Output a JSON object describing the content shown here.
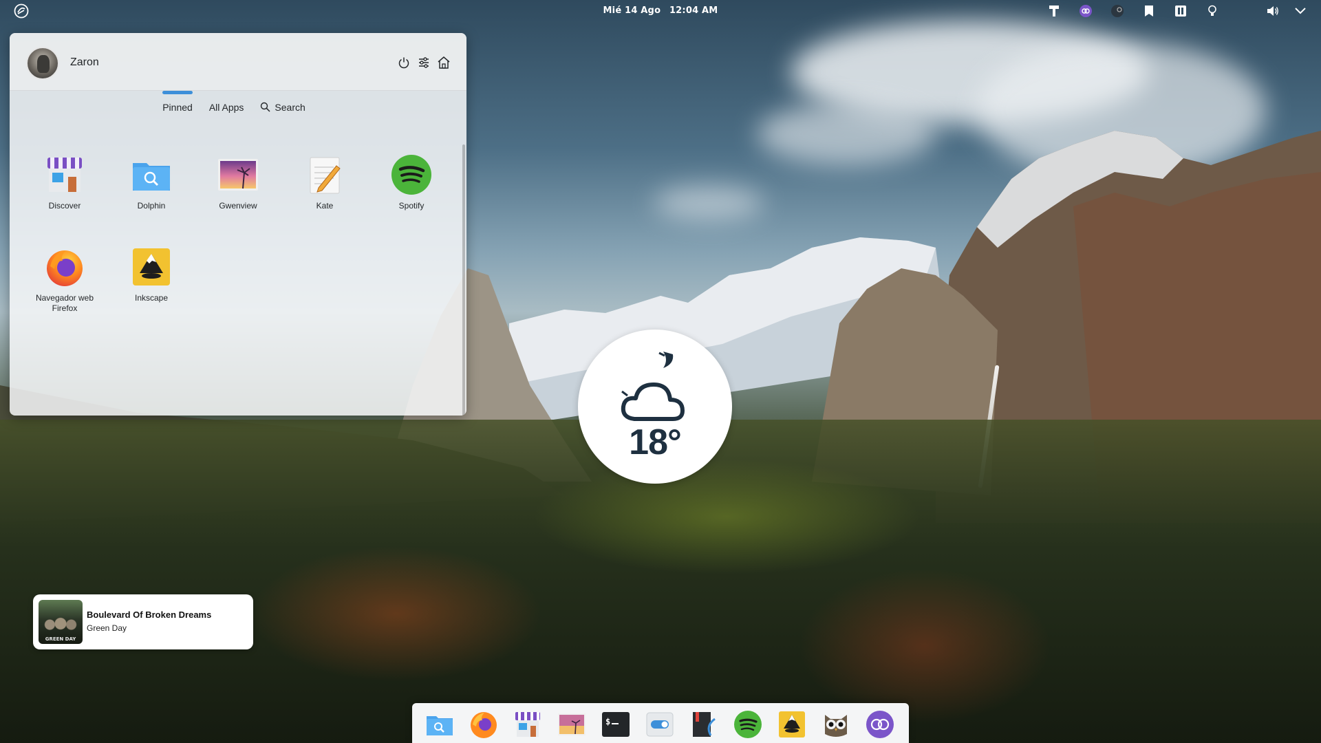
{
  "panel": {
    "date": "Mié 14 Ago",
    "time": "12:04 AM"
  },
  "launcher": {
    "user_name": "Zaron",
    "tabs": [
      {
        "label": "Pinned",
        "active": true
      },
      {
        "label": "All Apps",
        "active": false
      },
      {
        "label": "Search",
        "active": false
      }
    ],
    "apps": [
      {
        "label": "Discover",
        "icon": "discover-icon"
      },
      {
        "label": "Dolphin",
        "icon": "dolphin-icon"
      },
      {
        "label": "Gwenview",
        "icon": "gwenview-icon"
      },
      {
        "label": "Kate",
        "icon": "kate-icon"
      },
      {
        "label": "Spotify",
        "icon": "spotify-icon"
      },
      {
        "label": "Navegador web Firefox",
        "icon": "firefox-icon"
      },
      {
        "label": "Inkscape",
        "icon": "inkscape-icon"
      }
    ],
    "header_actions": [
      "power-icon",
      "settings-sliders-icon",
      "home-icon"
    ]
  },
  "weather": {
    "temperature": "18°",
    "condition_icon": "cloud-night-icon"
  },
  "now_playing": {
    "title": "Boulevard Of Broken Dreams",
    "artist": "Green Day",
    "album_art_text": "GREEN DAY"
  },
  "dock": {
    "items": [
      "dolphin-icon",
      "firefox-icon",
      "discover-icon",
      "gwenview-icon",
      "terminal-icon",
      "system-settings-icon",
      "kdenlive-icon",
      "spotify-icon",
      "inkscape-icon",
      "owl-icon",
      "purple-app-icon"
    ]
  },
  "colors": {
    "accent": "#3d8fd9",
    "launcher_bg": "#f6f7f8",
    "spotify": "#4bb43a"
  }
}
